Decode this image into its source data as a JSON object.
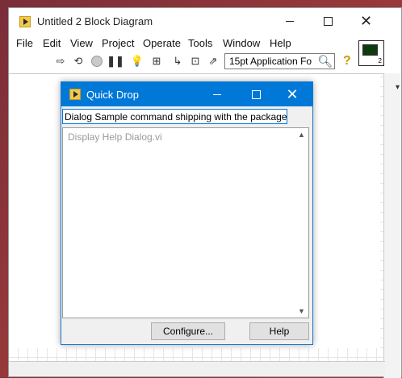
{
  "window": {
    "title": "Untitled 2 Block Diagram",
    "minimize_glyph": "",
    "close_glyph": "✕"
  },
  "menu": [
    "File",
    "Edit",
    "View",
    "Project",
    "Operate",
    "Tools",
    "Window",
    "Help"
  ],
  "toolbar": {
    "icons": [
      "run-arrow-icon",
      "run-continuously-icon",
      "abort-icon",
      "pause-icon",
      "highlight-execution-icon",
      "retain-wire-values-icon",
      "step-into-icon",
      "step-over-icon",
      "step-out-icon"
    ],
    "font_selector": "15pt Application Fo",
    "help_glyph": "?",
    "vi_icon_number": "2"
  },
  "dialog": {
    "title": "Quick Drop",
    "search_value": "Dialog Sample command shipping with the package",
    "list_items": [
      "Display Help Dialog.vi"
    ],
    "configure_button": "Configure...",
    "help_button": "Help",
    "accent_color": "#0078d7"
  }
}
